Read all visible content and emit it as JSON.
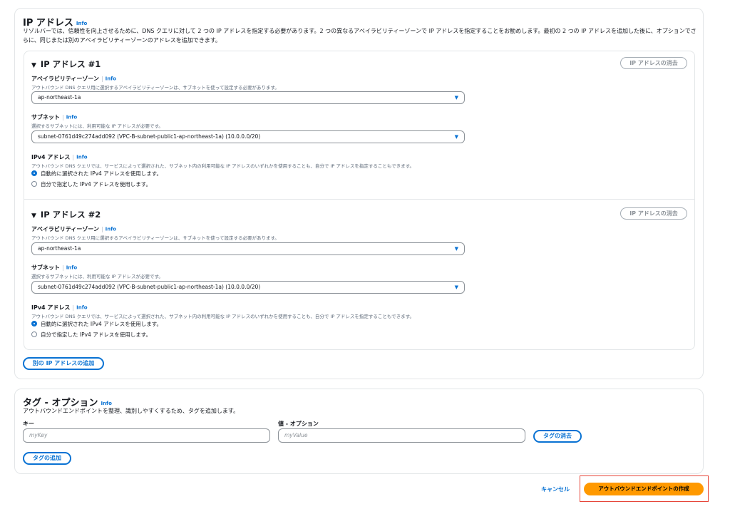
{
  "ip_section": {
    "title": "IP アドレス",
    "info": "Info",
    "description": "リゾルバーでは、信頼性を向上させるために、DNS クエリに対して 2 つの IP アドレスを指定する必要があります。2 つの異なるアベイラビリティーゾーンで IP アドレスを指定することをお勧めします。最初の 2 つの IP アドレスを追加した後に、オプションでさらに、同じまたは別のアベイラビリティーゾーンのアドレスを追加できます。",
    "entries": [
      {
        "title": "IP アドレス #1",
        "remove_label": "IP アドレスの消去",
        "az_label": "アベイラビリティーゾーン",
        "az_info": "Info",
        "az_desc": "アウトバウンド DNS クエリ用に選択するアベイラビリティーゾーンは、サブネットを使って設定する必要があります。",
        "az_value": "ap-northeast-1a",
        "subnet_label": "サブネット",
        "subnet_info": "Info",
        "subnet_desc": "選択するサブネットには、利用可能な IP アドレスが必要です。",
        "subnet_value": "subnet-0761d49c274add092 (VPC-B-subnet-public1-ap-northeast-1a) (10.0.0.0/20)",
        "ipv4_label": "IPv4 アドレス",
        "ipv4_info": "Info",
        "ipv4_desc": "アウトバウンド DNS クエリでは、サービスによって選択された、サブネット内の利用可能な IP アドレスのいずれかを使用することも、自分で IP アドレスを指定することもできます。",
        "radio_auto": "自動的に選択された IPv4 アドレスを使用します。",
        "radio_manual": "自分で指定した IPv4 アドレスを使用します。"
      },
      {
        "title": "IP アドレス #2",
        "remove_label": "IP アドレスの消去",
        "az_label": "アベイラビリティーゾーン",
        "az_info": "Info",
        "az_desc": "アウトバウンド DNS クエリ用に選択するアベイラビリティーゾーンは、サブネットを使って設定する必要があります。",
        "az_value": "ap-northeast-1a",
        "subnet_label": "サブネット",
        "subnet_info": "Info",
        "subnet_desc": "選択するサブネットには、利用可能な IP アドレスが必要です。",
        "subnet_value": "subnet-0761d49c274add092 (VPC-B-subnet-public1-ap-northeast-1a) (10.0.0.0/20)",
        "ipv4_label": "IPv4 アドレス",
        "ipv4_info": "Info",
        "ipv4_desc": "アウトバウンド DNS クエリでは、サービスによって選択された、サブネット内の利用可能な IP アドレスのいずれかを使用することも、自分で IP アドレスを指定することもできます。",
        "radio_auto": "自動的に選択された IPv4 アドレスを使用します。",
        "radio_manual": "自分で指定した IPv4 アドレスを使用します。"
      }
    ],
    "add_button": "別の IP アドレスの追加"
  },
  "tag_section": {
    "title": "タグ - オプション",
    "info": "Info",
    "description": "アウトバウンドエンドポイントを整理、識別しやすくするため、タグを追加します。",
    "key_label": "キー",
    "key_placeholder": "myKey",
    "value_label": "値 - オプション",
    "value_placeholder": "myValue",
    "remove_button": "タグの消去",
    "add_button": "タグの追加"
  },
  "footer": {
    "cancel": "キャンセル",
    "create": "アウトバウンドエンドポイントの作成"
  },
  "colors": {
    "link": "#0972d3",
    "primary_button": "#ff9900",
    "highlight": "#e6463a"
  }
}
